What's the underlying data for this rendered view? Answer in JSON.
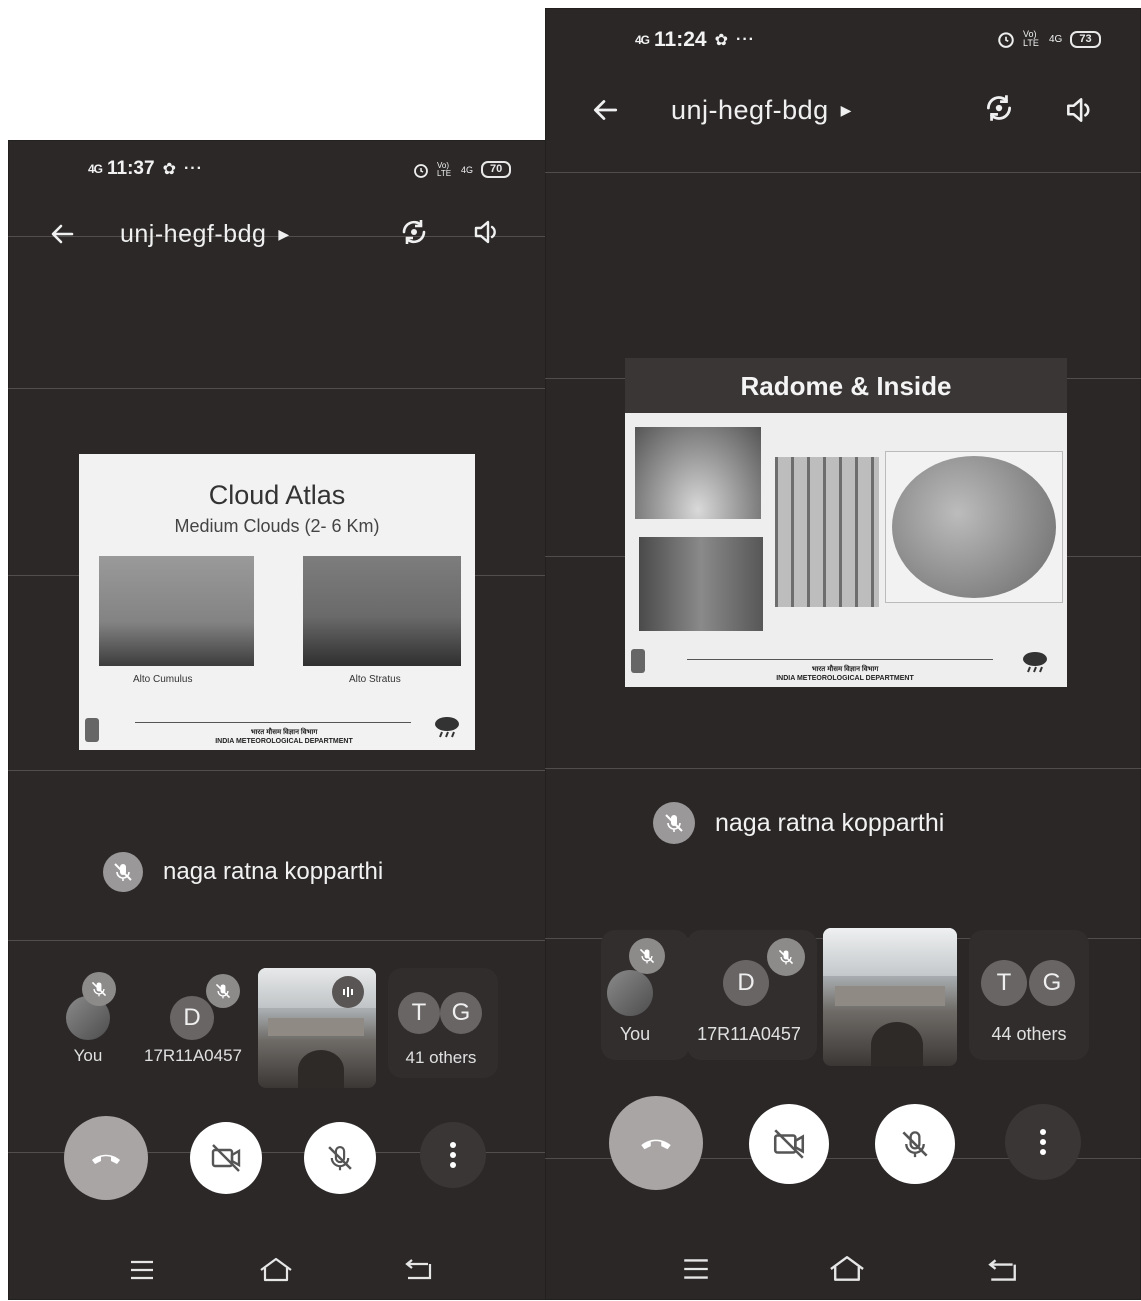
{
  "left": {
    "status": {
      "time": "11:37",
      "signal": "4G",
      "battery": "70",
      "volte": "Vo) LTE",
      "net": "4G"
    },
    "meeting_code": "unj-hegf-bdg",
    "slide": {
      "title": "Cloud Atlas",
      "subtitle": "Medium Clouds (2- 6 Km)",
      "caption_left": "Alto Cumulus",
      "caption_right": "Alto Stratus",
      "dept_hindi": "भारत मौसम विज्ञान विभाग",
      "dept_en": "INDIA METEOROLOGICAL DEPARTMENT"
    },
    "speaker": "naga ratna kopparthi",
    "participants": {
      "you": "You",
      "second_initial": "D",
      "second_label": "17R11A0457",
      "others_initials": [
        "T",
        "G"
      ],
      "others_label": "41 others"
    }
  },
  "right": {
    "status": {
      "time": "11:24",
      "signal": "4G",
      "battery": "73",
      "volte": "Vo) LTE",
      "net": "4G"
    },
    "meeting_code": "unj-hegf-bdg",
    "slide": {
      "title": "Radome & Inside",
      "dept_hindi": "भारत मौसम विज्ञान विभाग",
      "dept_en": "INDIA METEOROLOGICAL DEPARTMENT"
    },
    "speaker": "naga ratna kopparthi",
    "participants": {
      "you": "You",
      "second_initial": "D",
      "second_label": "17R11A0457",
      "others_initials": [
        "T",
        "G"
      ],
      "others_label": "44 others"
    }
  },
  "icons": {
    "back": "arrow-left-icon",
    "caret": "caret-right-icon",
    "camera_switch": "camera-switch-icon",
    "speaker": "speaker-icon",
    "mic_off": "mic-off-icon",
    "video_off": "video-off-icon",
    "end_call": "end-call-icon",
    "more": "more-vertical-icon",
    "menu": "menu-icon",
    "home": "home-icon",
    "back_nav": "back-nav-icon",
    "alarm": "alarm-icon",
    "settings": "gear-icon"
  }
}
